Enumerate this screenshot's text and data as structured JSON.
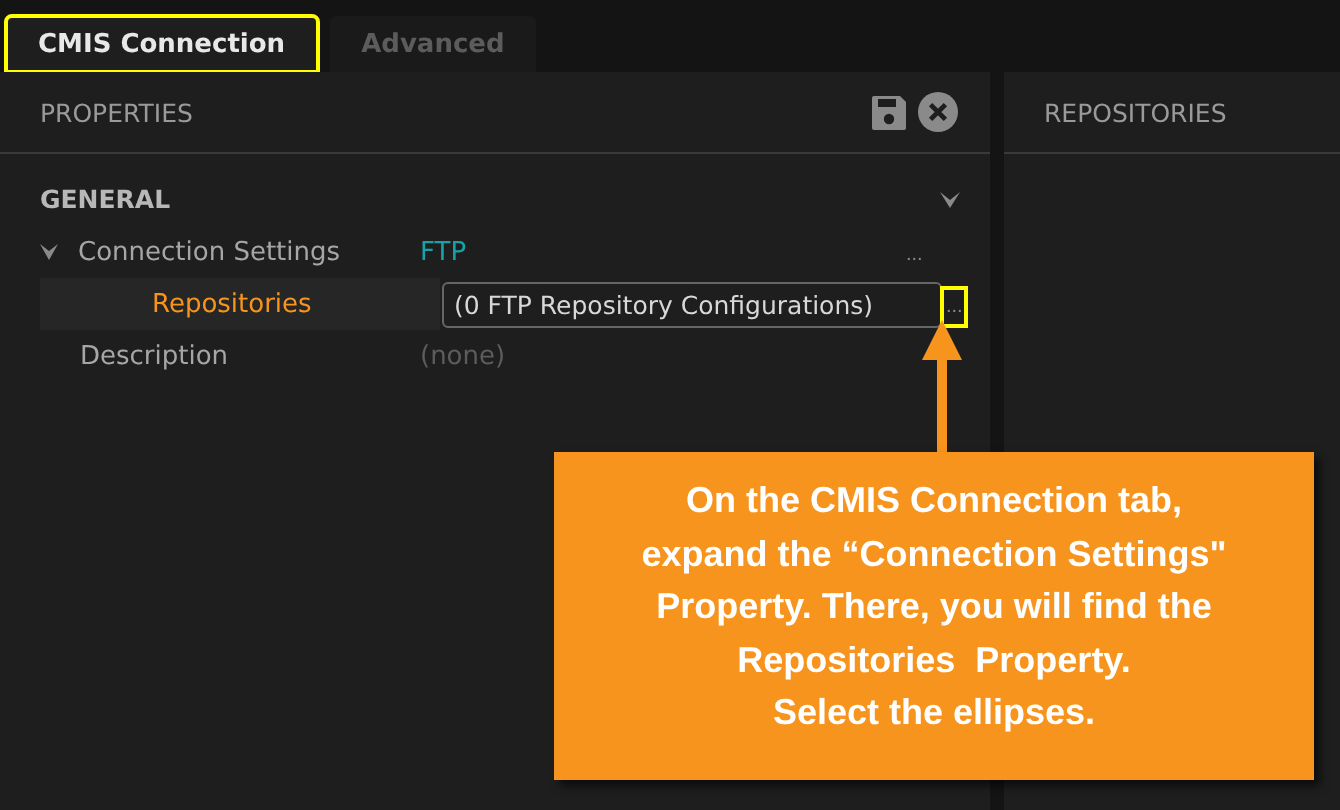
{
  "tabs": [
    {
      "label": "CMIS Connection",
      "selected": true,
      "highlighted": true
    },
    {
      "label": "Advanced",
      "selected": false,
      "highlighted": false
    }
  ],
  "properties_panel": {
    "title": "PROPERTIES",
    "group": {
      "title": "GENERAL",
      "expanded": true,
      "rows": [
        {
          "label": "Connection Settings",
          "value": "FTP",
          "kind": "link",
          "expanded": true,
          "selected": false,
          "action": "...",
          "highlighted": false,
          "children": [
            {
              "label": "Repositories",
              "value": "(0 FTP Repository Configurations)",
              "kind": "field",
              "selected": true,
              "action": "...",
              "highlighted": true
            }
          ]
        },
        {
          "label": "Description",
          "value": "(none)",
          "kind": "empty",
          "selected": false
        }
      ]
    }
  },
  "repositories_panel": {
    "title": "REPOSITORIES"
  },
  "callout": {
    "text": "On the CMIS Connection tab,\nexpand the “Connection Settings\"\nProperty. There, you will find the\nRepositories  Property.\nSelect the ellipses."
  }
}
